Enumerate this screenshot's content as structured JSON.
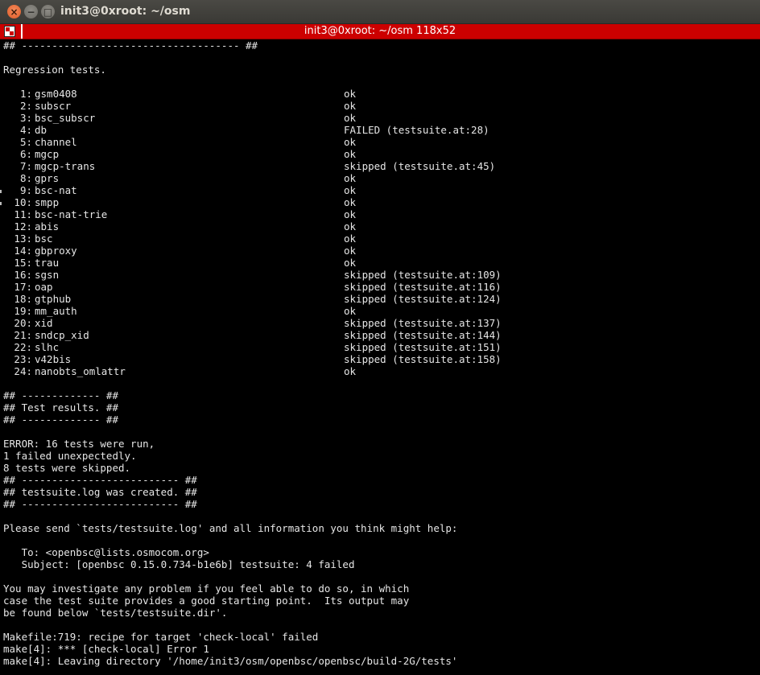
{
  "window": {
    "title": "init3@0xroot: ~/osm",
    "tab_title": "init3@0xroot: ~/osm 118x52",
    "controls": {
      "close": "×",
      "minimize": "−",
      "maximize": "□"
    }
  },
  "terminal": {
    "header_lines": [
      "## ------------------------------------ ##",
      "",
      "Regression tests.",
      ""
    ],
    "tests": [
      {
        "num": "1:",
        "name": "gsm0408",
        "status": "ok"
      },
      {
        "num": "2:",
        "name": "subscr",
        "status": "ok"
      },
      {
        "num": "3:",
        "name": "bsc_subscr",
        "status": "ok"
      },
      {
        "num": "4:",
        "name": "db",
        "status": "FAILED (testsuite.at:28)"
      },
      {
        "num": "5:",
        "name": "channel",
        "status": "ok"
      },
      {
        "num": "6:",
        "name": "mgcp",
        "status": "ok"
      },
      {
        "num": "7:",
        "name": "mgcp-trans",
        "status": "skipped (testsuite.at:45)"
      },
      {
        "num": "8:",
        "name": "gprs",
        "status": "ok"
      },
      {
        "num": "9:",
        "name": "bsc-nat",
        "status": "ok"
      },
      {
        "num": "10:",
        "name": "smpp",
        "status": "ok"
      },
      {
        "num": "11:",
        "name": "bsc-nat-trie",
        "status": "ok"
      },
      {
        "num": "12:",
        "name": "abis",
        "status": "ok"
      },
      {
        "num": "13:",
        "name": "bsc",
        "status": "ok"
      },
      {
        "num": "14:",
        "name": "gbproxy",
        "status": "ok"
      },
      {
        "num": "15:",
        "name": "trau",
        "status": "ok"
      },
      {
        "num": "16:",
        "name": "sgsn",
        "status": "skipped (testsuite.at:109)"
      },
      {
        "num": "17:",
        "name": "oap",
        "status": "skipped (testsuite.at:116)"
      },
      {
        "num": "18:",
        "name": "gtphub",
        "status": "skipped (testsuite.at:124)"
      },
      {
        "num": "19:",
        "name": "mm_auth",
        "status": "ok"
      },
      {
        "num": "20:",
        "name": "xid",
        "status": "skipped (testsuite.at:137)"
      },
      {
        "num": "21:",
        "name": "sndcp_xid",
        "status": "skipped (testsuite.at:144)"
      },
      {
        "num": "22:",
        "name": "slhc",
        "status": "skipped (testsuite.at:151)"
      },
      {
        "num": "23:",
        "name": "v42bis",
        "status": "skipped (testsuite.at:158)"
      },
      {
        "num": "24:",
        "name": "nanobts_omlattr",
        "status": "ok"
      }
    ],
    "footer_lines": [
      "",
      "## ------------- ##",
      "## Test results. ##",
      "## ------------- ##",
      "",
      "ERROR: 16 tests were run,",
      "1 failed unexpectedly.",
      "8 tests were skipped.",
      "## -------------------------- ##",
      "## testsuite.log was created. ##",
      "## -------------------------- ##",
      "",
      "Please send `tests/testsuite.log' and all information you think might help:",
      "",
      "   To: <openbsc@lists.osmocom.org>",
      "   Subject: [openbsc 0.15.0.734-b1e6b] testsuite: 4 failed",
      "",
      "You may investigate any problem if you feel able to do so, in which",
      "case the test suite provides a good starting point.  Its output may",
      "be found below `tests/testsuite.dir'.",
      "",
      "Makefile:719: recipe for target 'check-local' failed",
      "make[4]: *** [check-local] Error 1",
      "make[4]: Leaving directory '/home/init3/osm/openbsc/openbsc/build-2G/tests'"
    ]
  },
  "colors": {
    "tab_bar": "#cc0000",
    "terminal_bg": "#000000",
    "terminal_fg": "#e6e6e6",
    "titlebar_bg": "#3c3b37"
  }
}
